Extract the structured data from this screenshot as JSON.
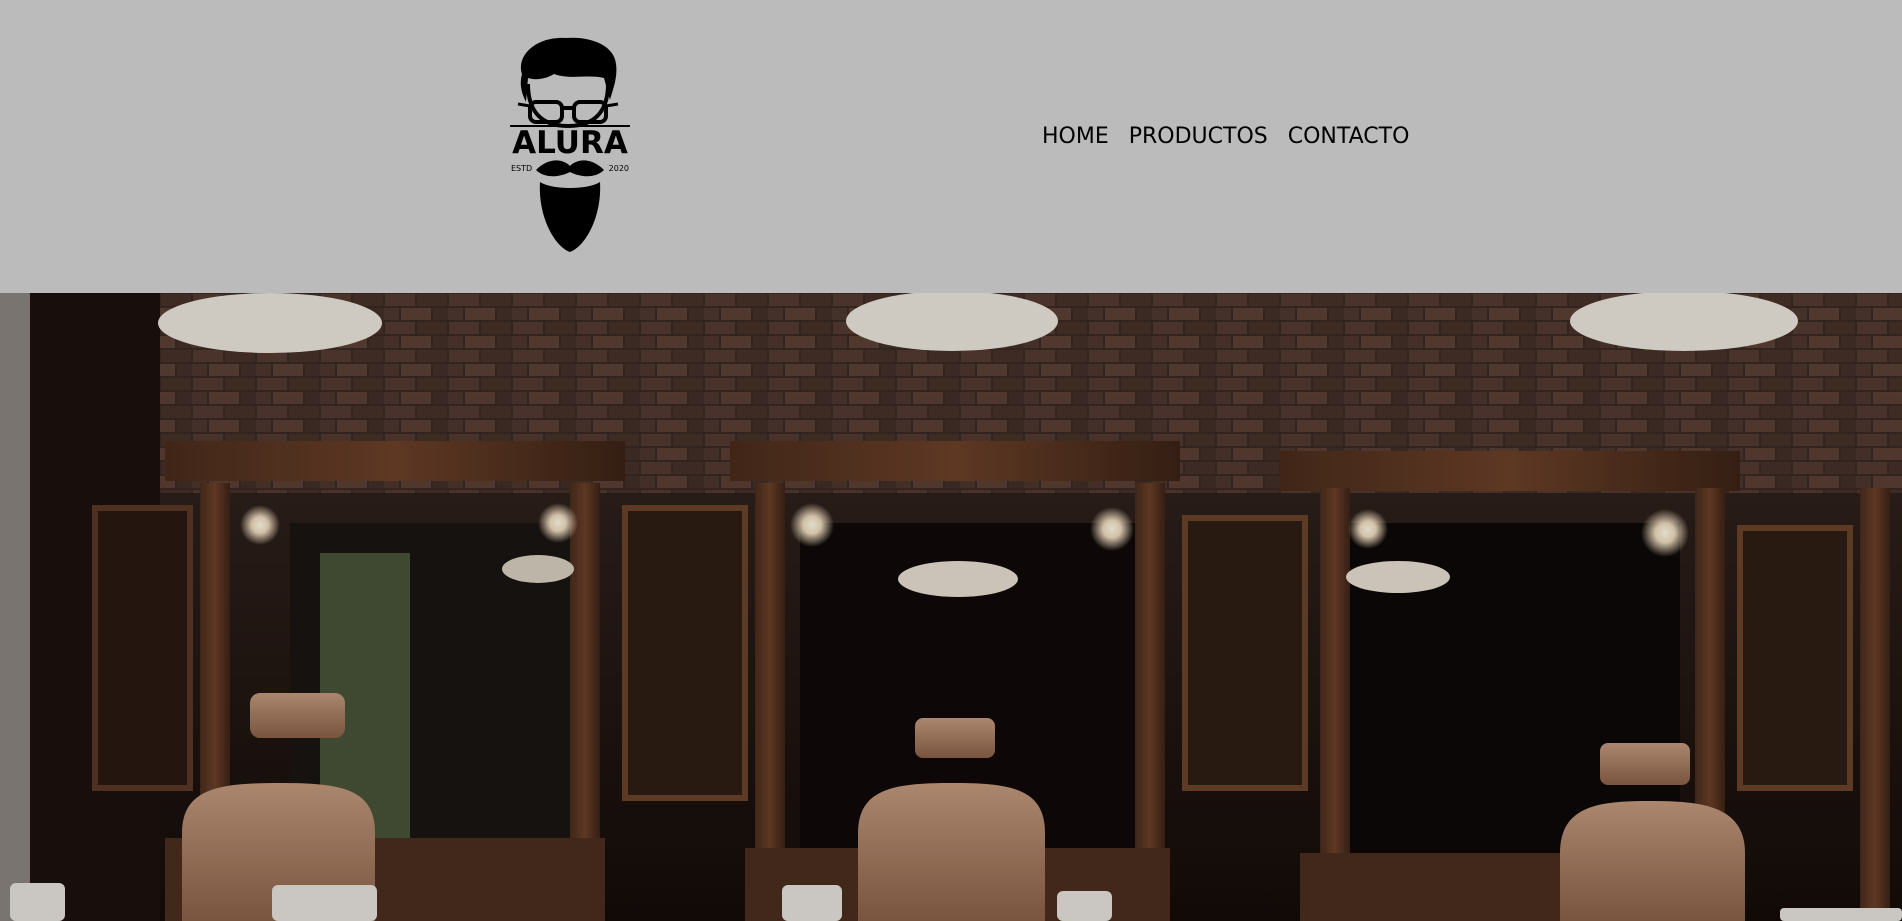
{
  "logo": {
    "icon": "bearded-man-glasses-logo",
    "brand": "ALURA",
    "estd": "ESTD",
    "year": "2020"
  },
  "nav": {
    "items": [
      {
        "label": "HOME"
      },
      {
        "label": "PRODUCTOS"
      },
      {
        "label": "CONTACTO"
      }
    ]
  },
  "hero": {
    "image": "barbershop-interior-photo"
  },
  "colors": {
    "header_bg": "#bbbbbb",
    "nav_text": "#000000"
  }
}
